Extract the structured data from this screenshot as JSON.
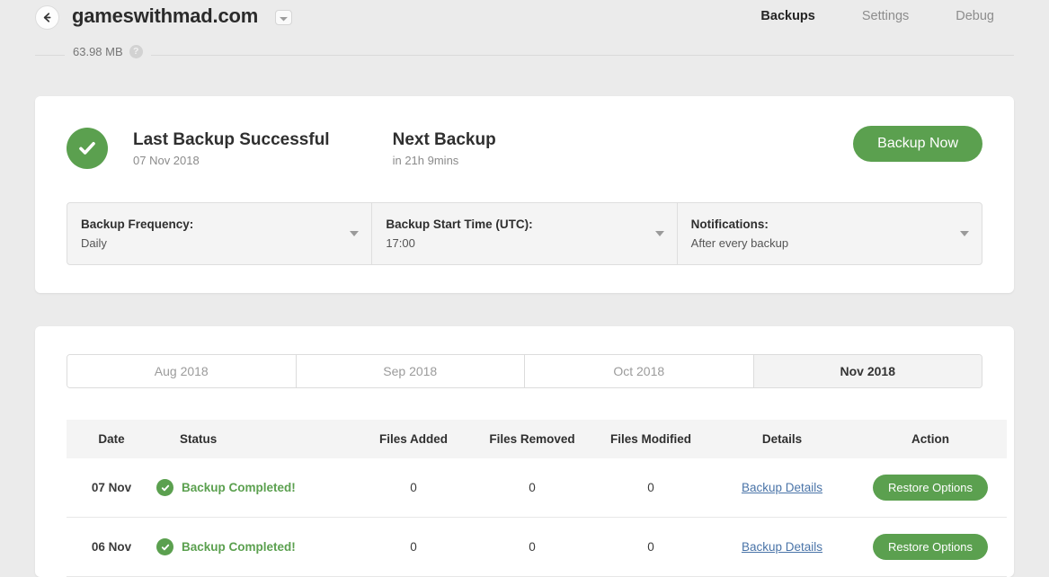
{
  "header": {
    "back_icon": "arrow-left-icon",
    "site_title": "gameswithmad.com",
    "site_caret_icon": "chevron-down-icon",
    "nav": [
      {
        "label": "Backups",
        "active": true
      },
      {
        "label": "Settings",
        "active": false
      },
      {
        "label": "Debug",
        "active": false
      }
    ]
  },
  "storage": {
    "size_label": "63.98 MB",
    "help_icon": "question-mark-icon",
    "help_glyph": "?"
  },
  "status_card": {
    "check_icon": "check-circle-icon",
    "last_backup_title": "Last Backup Successful",
    "last_backup_date": "07 Nov 2018",
    "next_backup_title": "Next Backup",
    "next_backup_eta": "in 21h 9mins",
    "backup_now_label": "Backup Now",
    "selects": [
      {
        "label": "Backup Frequency:",
        "value": "Daily"
      },
      {
        "label": "Backup Start Time (UTC):",
        "value": "17:00"
      },
      {
        "label": "Notifications:",
        "value": "After every backup"
      }
    ]
  },
  "history_card": {
    "tabs": [
      {
        "label": "Aug 2018",
        "active": false
      },
      {
        "label": "Sep 2018",
        "active": false
      },
      {
        "label": "Oct 2018",
        "active": false
      },
      {
        "label": "Nov 2018",
        "active": true
      }
    ],
    "columns": [
      "Date",
      "Status",
      "Files Added",
      "Files Removed",
      "Files Modified",
      "Details",
      "Action"
    ],
    "rows": [
      {
        "date": "07 Nov",
        "status": "Backup Completed!",
        "files_added": "0",
        "files_removed": "0",
        "files_modified": "0",
        "details_label": "Backup Details",
        "action_label": "Restore Options"
      },
      {
        "date": "06 Nov",
        "status": "Backup Completed!",
        "files_added": "0",
        "files_removed": "0",
        "files_modified": "0",
        "details_label": "Backup Details",
        "action_label": "Restore Options"
      }
    ]
  },
  "colors": {
    "page_background": "#ebebeb",
    "card_background": "#ffffff",
    "brand_green": "#5ba04f",
    "link_blue": "#4a74a8",
    "text_dark": "#2f2f2f",
    "text_muted": "#8b8b8b"
  }
}
